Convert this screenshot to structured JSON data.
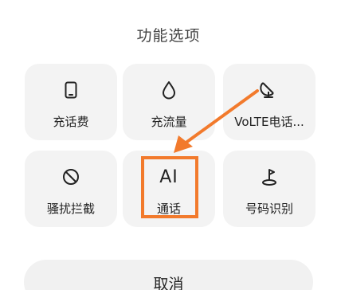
{
  "sheet": {
    "title": "功能选项"
  },
  "options": [
    {
      "id": "recharge-bill",
      "label": "充话费",
      "icon": "phone-outline-icon"
    },
    {
      "id": "recharge-data",
      "label": "充流量",
      "icon": "water-drop-icon"
    },
    {
      "id": "volte-call",
      "label": "VoLTE电话...",
      "icon": "satellite-dish-icon"
    },
    {
      "id": "harassment-block",
      "label": "骚扰拦截",
      "icon": "block-icon"
    },
    {
      "id": "ai-call",
      "icon_text": "AI",
      "label": "通话",
      "icon": "ai-text-icon"
    },
    {
      "id": "number-id",
      "label": "号码识别",
      "icon": "location-flag-icon"
    }
  ],
  "cancel": {
    "label": "取消"
  },
  "annotation": {
    "arrow_color": "#f27a2c",
    "highlight_color": "#f27a2c"
  }
}
